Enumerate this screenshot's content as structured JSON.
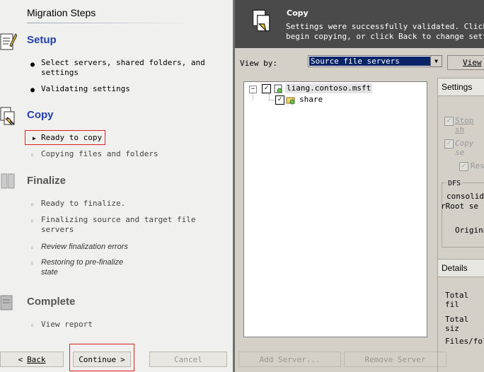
{
  "left": {
    "heading": "Migration Steps",
    "sections": {
      "setup": {
        "title": "Setup",
        "steps": [
          "Select servers, shared folders, and settings",
          "Validating settings"
        ]
      },
      "copy": {
        "title": "Copy",
        "steps": [
          "Ready to copy",
          "Copying files and folders"
        ]
      },
      "finalize": {
        "title": "Finalize",
        "steps": [
          "Ready to finalize.",
          "Finalizing source and target file servers",
          "Review finalization errors",
          "Restoring to pre-finalize state"
        ]
      },
      "complete": {
        "title": "Complete",
        "steps": [
          "View report"
        ]
      }
    },
    "buttons": {
      "back": "Back",
      "continue": "Continue",
      "cancel": "Cancel"
    }
  },
  "right": {
    "banner": {
      "title": "Copy",
      "message_line1": "Settings were successfully validated. Click Con",
      "message_line2": "begin copying, or click Back to change settings"
    },
    "view_by_label": "View by:",
    "view_by_value": "Source file servers",
    "view_button": "View",
    "tree": {
      "server": "liang.contoso.msft",
      "share": "share",
      "expander": "−"
    },
    "buttons": {
      "add_server": "Add Server...",
      "remove_server": "Remove Server"
    },
    "settings": {
      "title": "Settings",
      "opt1": "Stop sh",
      "opt2": "Copy se",
      "opt3": "Res",
      "dfs_label": "DFS",
      "dfs_line1": "consolid",
      "dfs_line2": "Root se",
      "origin": "Origina"
    },
    "details": {
      "title": "Details",
      "total_files": "Total fil",
      "total_size": "Total siz",
      "files_folders": "Files/fol"
    }
  },
  "colors": {
    "active": "#1f3fae",
    "highlight": "#e02020",
    "banner": "#4a4a4a"
  }
}
